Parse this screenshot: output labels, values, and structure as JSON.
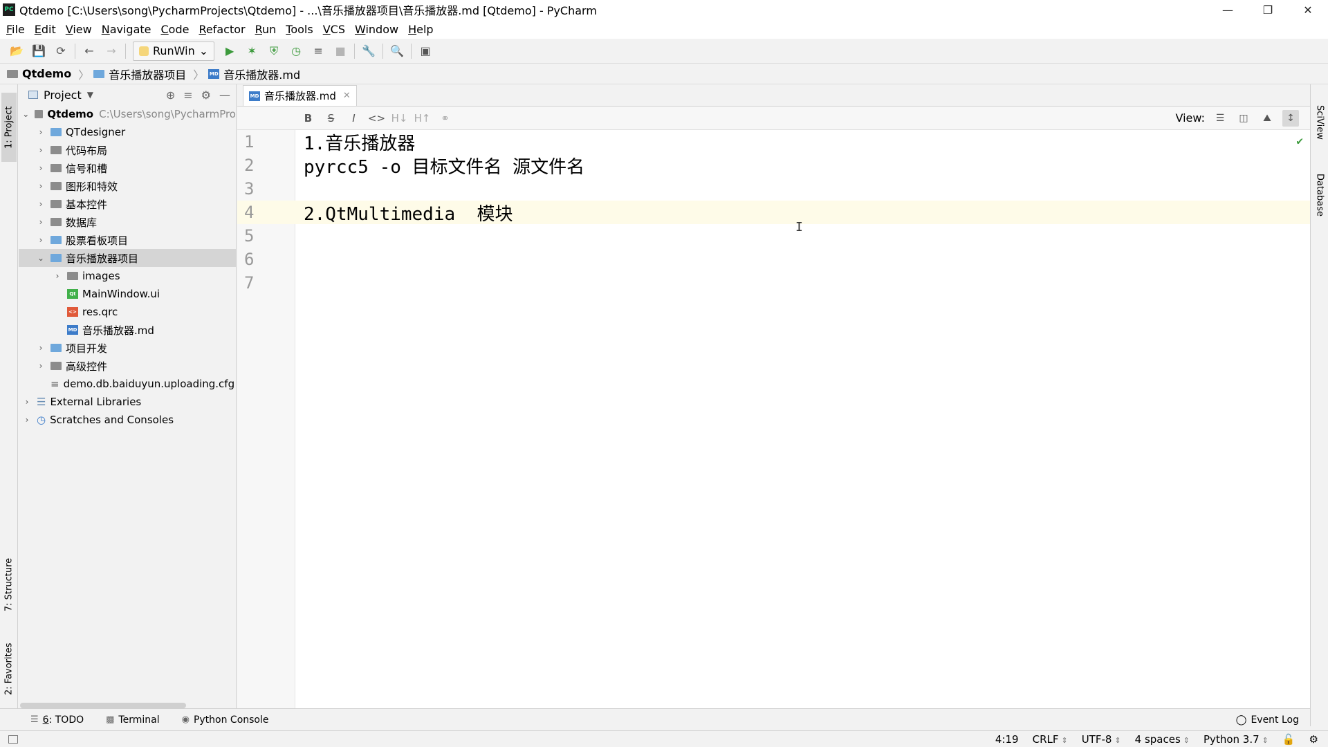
{
  "window": {
    "title": "Qtdemo [C:\\Users\\song\\PycharmProjects\\Qtdemo] - ...\\音乐播放器项目\\音乐播放器.md [Qtdemo] - PyCharm",
    "app_icon": "PC"
  },
  "menu": [
    "File",
    "Edit",
    "View",
    "Navigate",
    "Code",
    "Refactor",
    "Run",
    "Tools",
    "VCS",
    "Window",
    "Help"
  ],
  "toolbar": {
    "run_config": "RunWin"
  },
  "breadcrumb": [
    "Qtdemo",
    "音乐播放器项目",
    "音乐播放器.md"
  ],
  "left_tool_tabs": {
    "project": "1: Project",
    "structure": "7: Structure",
    "favorites": "2: Favorites"
  },
  "right_tool_tabs": {
    "sciview": "SciView",
    "database": "Database"
  },
  "project_panel": {
    "title": "Project",
    "root": {
      "name": "Qtdemo",
      "path": "C:\\Users\\song\\PycharmPro"
    },
    "items": [
      {
        "label": "QTdesigner"
      },
      {
        "label": "代码布局"
      },
      {
        "label": "信号和槽"
      },
      {
        "label": "图形和特效"
      },
      {
        "label": "基本控件"
      },
      {
        "label": "数据库"
      },
      {
        "label": "股票看板项目"
      },
      {
        "label": "音乐播放器项目"
      },
      {
        "label": "images"
      },
      {
        "label": "MainWindow.ui"
      },
      {
        "label": "res.qrc"
      },
      {
        "label": "音乐播放器.md"
      },
      {
        "label": "项目开发"
      },
      {
        "label": "高级控件"
      },
      {
        "label": "demo.db.baiduyun.uploading.cfg"
      },
      {
        "label": "External Libraries"
      },
      {
        "label": "Scratches and Consoles"
      }
    ],
    "file_badges": {
      "ui": "Qt",
      "qrc": "<>",
      "md": "MD"
    }
  },
  "editor": {
    "tab_label": "音乐播放器.md",
    "view_label": "View:",
    "md_tools": [
      "B",
      "S",
      "I",
      "<>",
      "H↓",
      "H↑",
      "⚭"
    ],
    "lines": [
      {
        "num": "1",
        "text": "1.音乐播放器"
      },
      {
        "num": "2",
        "text": "pyrcc5 -o 目标文件名 源文件名"
      },
      {
        "num": "3",
        "text": ""
      },
      {
        "num": "4",
        "text": "2.QtMultimedia  模块"
      },
      {
        "num": "5",
        "text": ""
      },
      {
        "num": "6",
        "text": ""
      },
      {
        "num": "7",
        "text": ""
      }
    ]
  },
  "bottom_tabs": {
    "todo_num": "6",
    "todo": ": TODO",
    "terminal": "Terminal",
    "python_console": "Python Console",
    "event_log": "Event Log"
  },
  "status": {
    "position": "4:19",
    "line_sep": "CRLF",
    "encoding": "UTF-8",
    "indent": "4 spaces",
    "interpreter": "Python 3.7"
  }
}
